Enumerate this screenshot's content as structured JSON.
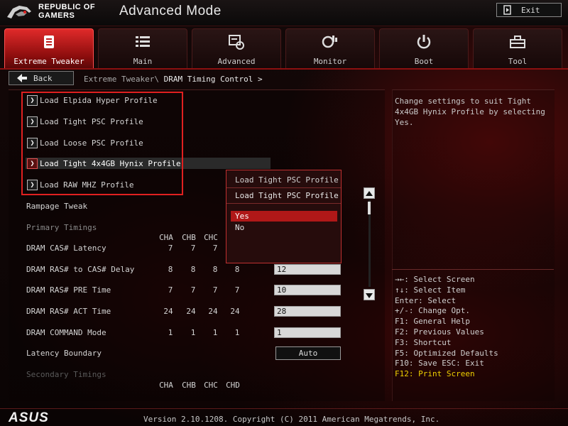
{
  "header": {
    "brand_line1": "REPUBLIC OF",
    "brand_line2": "GAMERS",
    "title": "Advanced Mode",
    "exit_label": "Exit"
  },
  "tabs": [
    {
      "label": "Extreme Tweaker",
      "icon": "tweaker-icon",
      "active": true
    },
    {
      "label": "Main",
      "icon": "list-icon"
    },
    {
      "label": "Advanced",
      "icon": "advanced-icon"
    },
    {
      "label": "Monitor",
      "icon": "monitor-icon"
    },
    {
      "label": "Boot",
      "icon": "power-icon"
    },
    {
      "label": "Tool",
      "icon": "toolbox-icon"
    }
  ],
  "breadcrumb": {
    "back_label": "Back",
    "parent": "Extreme Tweaker\\",
    "current": "DRAM Timing Control >"
  },
  "profiles": [
    "Load Elpida Hyper Profile",
    "Load Tight PSC Profile",
    "Load Loose PSC Profile",
    "Load Tight 4x4GB Hynix Profile",
    "Load RAW MHZ Profile"
  ],
  "settings": {
    "rampage_tweak": "Rampage Tweak",
    "primary_timings": "Primary Timings",
    "channel_headers": [
      "CHA",
      "CHB",
      "CHC",
      "CHD"
    ],
    "rows": [
      {
        "label": "DRAM CAS# Latency",
        "values": [
          "7",
          "7",
          "7"
        ],
        "field": ""
      },
      {
        "label": "DRAM RAS# to CAS# Delay",
        "values": [
          "8",
          "8",
          "8",
          "8"
        ],
        "field": "12"
      },
      {
        "label": "DRAM RAS# PRE Time",
        "values": [
          "7",
          "7",
          "7",
          "7"
        ],
        "field": "10"
      },
      {
        "label": "DRAM RAS# ACT Time",
        "values": [
          "24",
          "24",
          "24",
          "24"
        ],
        "field": "28"
      },
      {
        "label": "DRAM COMMAND Mode",
        "values": [
          "1",
          "1",
          "1",
          "1"
        ],
        "field": "1"
      }
    ],
    "latency_boundary": "Latency Boundary",
    "latency_boundary_value": "Auto",
    "secondary_timings": "Secondary Timings"
  },
  "popup": {
    "title": "Load Tight PSC Profile",
    "subtitle": "Load Tight PSC Profile",
    "options": [
      "Yes",
      "No"
    ],
    "selected": "Yes"
  },
  "help": {
    "description": "Change settings to suit Tight 4x4GB Hynix Profile by selecting Yes.",
    "keys": [
      "→←: Select Screen",
      "↑↓: Select Item",
      "Enter: Select",
      "+/-: Change Opt.",
      "F1: General Help",
      "F2: Previous Values",
      "F3: Shortcut",
      "F5: Optimized Defaults",
      "F10: Save  ESC: Exit",
      "F12: Print Screen"
    ]
  },
  "footer": {
    "brand": "ASUS",
    "version": "Version 2.10.1208. Copyright (C) 2011 American Megatrends, Inc."
  },
  "colors": {
    "accent": "#c01818",
    "highlight_key": "#f0d000"
  }
}
